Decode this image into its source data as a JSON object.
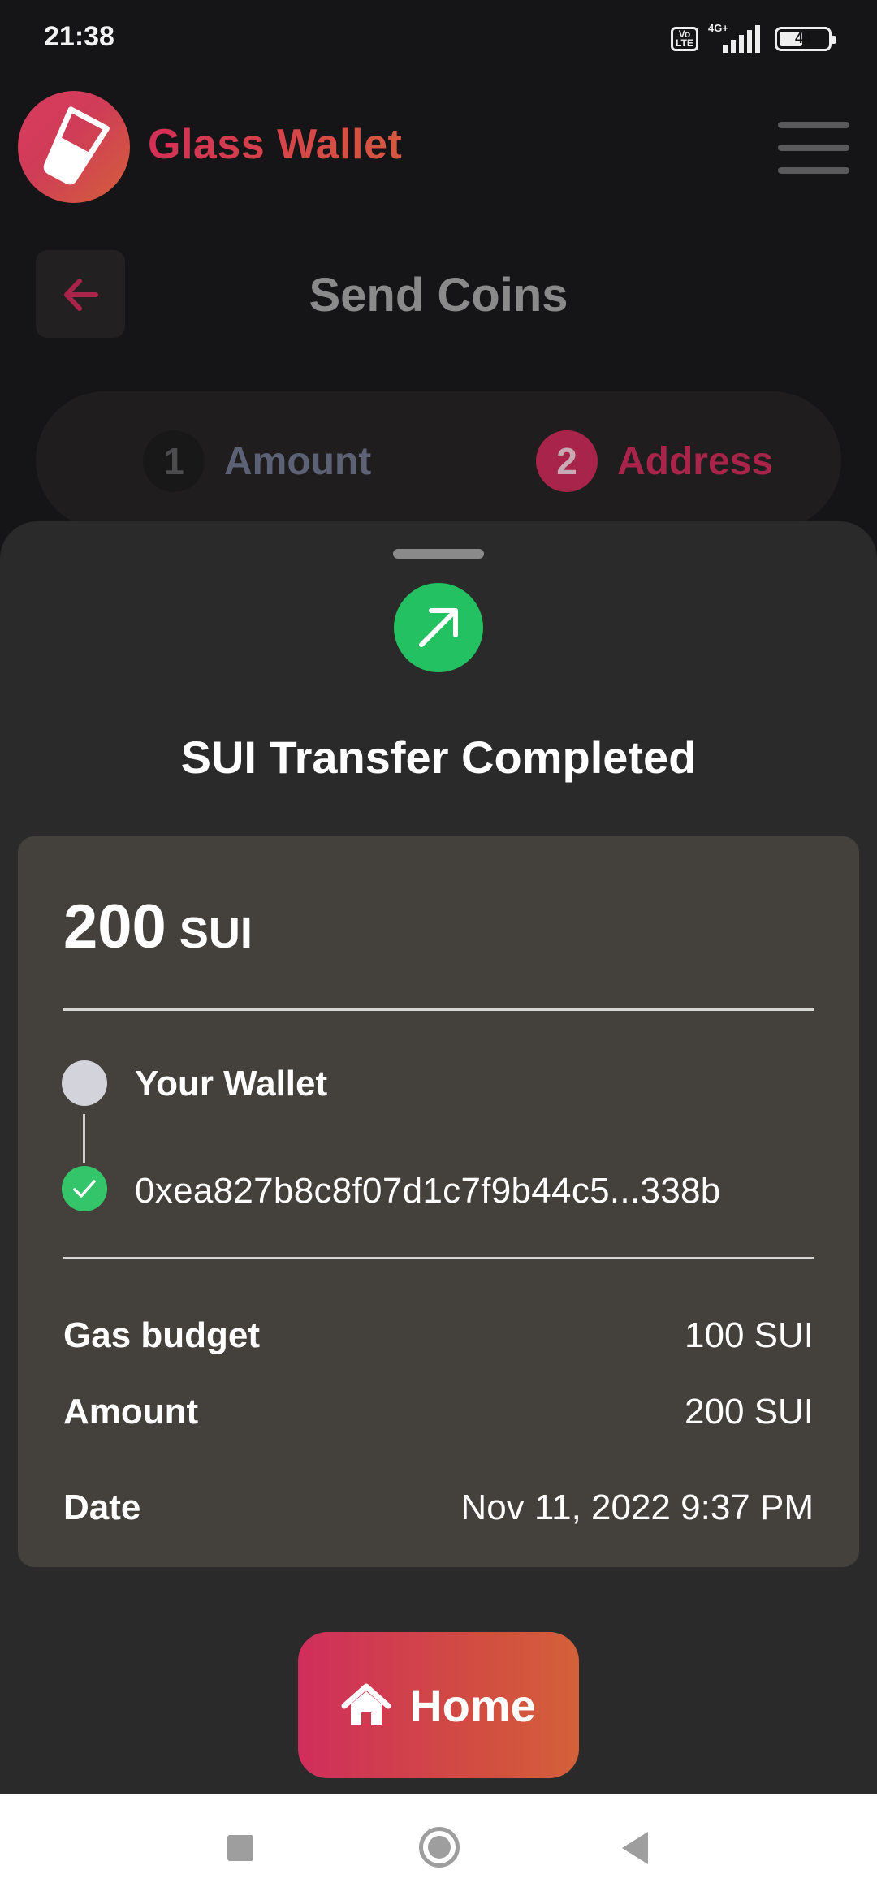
{
  "status_bar": {
    "time": "21:38",
    "volte_label": "Vo LTE",
    "network_label": "4G+",
    "battery_level": "44"
  },
  "header": {
    "app_name": "Glass Wallet",
    "logo_icon": "glass-icon",
    "menu_icon": "hamburger-menu-icon"
  },
  "page": {
    "title": "Send Coins",
    "back_icon": "arrow-left-icon"
  },
  "stepper": {
    "steps": [
      {
        "number": "1",
        "label": "Amount",
        "active": false
      },
      {
        "number": "2",
        "label": "Address",
        "active": true
      }
    ]
  },
  "sheet": {
    "icon": "arrow-up-right-icon",
    "title": "SUI Transfer Completed",
    "amount_value": "200",
    "amount_unit": "SUI",
    "from_label": "Your Wallet",
    "to_address": "0xea827b8c8f07d1c7f9b44c5...338b",
    "details": [
      {
        "label": "Gas budget",
        "value": "100 SUI"
      },
      {
        "label": "Amount",
        "value": "200 SUI"
      },
      {
        "label": "Date",
        "value": "Nov 11, 2022 9:37 PM"
      }
    ],
    "home_button_label": "Home"
  },
  "colors": {
    "accent_pink": "#cf2e5b",
    "accent_orange": "#d4613a",
    "success_green": "#23c161",
    "card_bg": "#44413d",
    "sheet_bg": "#2a2a2a"
  }
}
